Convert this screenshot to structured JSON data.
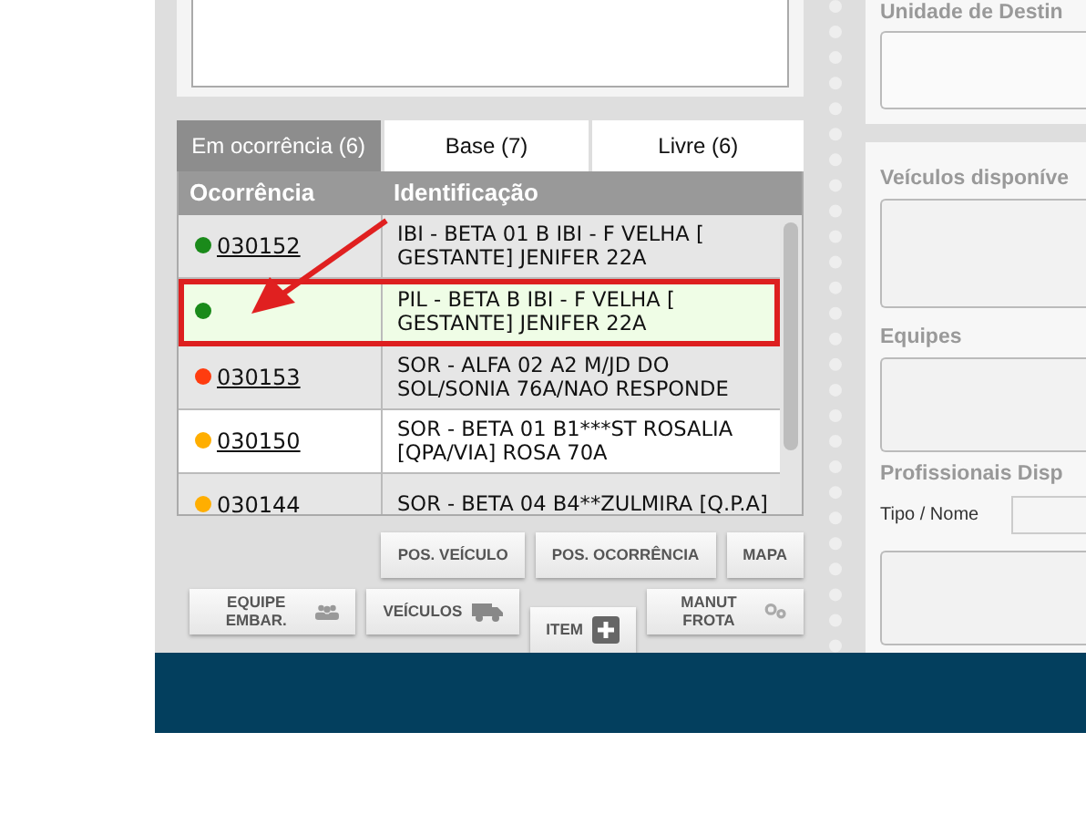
{
  "tabs": [
    {
      "label": "Em ocorrência (6)",
      "selected": true
    },
    {
      "label": "Base (7)",
      "selected": false
    },
    {
      "label": "Livre (6)",
      "selected": false
    }
  ],
  "table": {
    "columns": [
      "Ocorrência",
      "Identificação"
    ],
    "rows": [
      {
        "color": "#1a8a1a",
        "code": "030152",
        "identification": "IBI - BETA 01 B IBI - F VELHA [ GESTANTE] JENIFER 22A",
        "selected": false,
        "highlighted": false
      },
      {
        "color": "#1a8a1a",
        "identification": "PIL - BETA B IBI - F VELHA [ GESTANTE] JENIFER 22A",
        "selected": true,
        "highlighted": true
      },
      {
        "color": "#ff3c0f",
        "code": "030153",
        "identification": "SOR - ALFA 02 A2 M/JD DO SOL/SONIA 76A/NAO RESPONDE",
        "selected": false,
        "highlighted": false
      },
      {
        "color": "#ffae00",
        "code": "030150",
        "identification": "SOR - BETA 01 B1***ST ROSALIA [QPA/VIA] ROSA 70A",
        "selected": false,
        "highlighted": false
      },
      {
        "color": "#ffae00",
        "code": "030144",
        "identification": "SOR - BETA 04 B4**ZULMIRA [Q.P.A]",
        "selected": false,
        "highlighted": false
      }
    ]
  },
  "buttons_row_1": [
    {
      "label": "POS. VEÍCULO"
    },
    {
      "label": "POS. OCORRÊNCIA"
    },
    {
      "label": "MAPA"
    }
  ],
  "buttons_row_2": [
    {
      "label": "EQUIPE EMBAR.",
      "kind": "team"
    },
    {
      "label": "VEÍCULOS",
      "kind": "vehicle"
    },
    {
      "label": "ITEM",
      "kind": "add"
    },
    {
      "label": "MANUT FROTA",
      "kind": "gears"
    }
  ],
  "right_panel": {
    "destination_label": "Unidade de Destin",
    "vehicles_label": "Veículos disponíve",
    "teams_label": "Equipes",
    "professionals_label": "Profissionais Disp",
    "type_name_label": "Tipo / Nome"
  }
}
